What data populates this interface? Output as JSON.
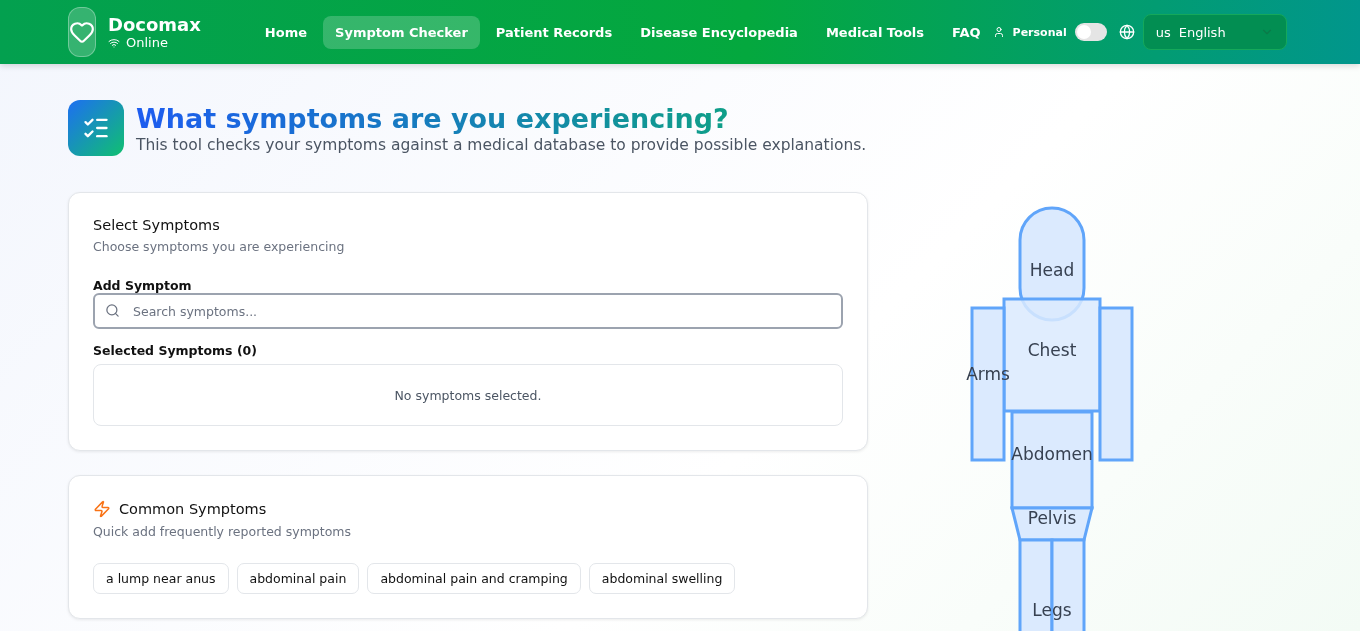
{
  "brand": {
    "name": "Docomax",
    "status": "Online"
  },
  "nav": [
    {
      "label": "Home",
      "selected": false
    },
    {
      "label": "Symptom Checker",
      "selected": true
    },
    {
      "label": "Patient Records",
      "selected": false
    },
    {
      "label": "Disease Encyclopedia",
      "selected": false
    },
    {
      "label": "Medical Tools",
      "selected": false
    },
    {
      "label": "FAQ",
      "selected": false
    }
  ],
  "mode": {
    "label": "Personal",
    "on": false
  },
  "language": {
    "code": "us",
    "name": "English"
  },
  "heading": {
    "title": "What symptoms are you experiencing?",
    "subtitle": "This tool checks your symptoms against a medical database to provide possible explanations."
  },
  "select_card": {
    "title": "Select Symptoms",
    "subtitle": "Choose symptoms you are experiencing",
    "field_label": "Add Symptom",
    "placeholder": "Search symptoms...",
    "selected_label": "Selected Symptoms (0)",
    "empty_text": "No symptoms selected."
  },
  "common_card": {
    "title": "Common Symptoms",
    "subtitle": "Quick add frequently reported symptoms",
    "chips": [
      "a lump near anus",
      "abdominal pain",
      "abdominal pain and cramping",
      "abdominal swelling"
    ]
  },
  "body_map": [
    {
      "kind": "head",
      "label": "Head"
    },
    {
      "kind": "chest",
      "label": "Chest"
    },
    {
      "kind": "arms",
      "label": "Arms"
    },
    {
      "kind": "abdomen",
      "label": "Abdomen"
    },
    {
      "kind": "pelvis",
      "label": "Pelvis"
    },
    {
      "kind": "legs",
      "label": "Legs"
    }
  ]
}
